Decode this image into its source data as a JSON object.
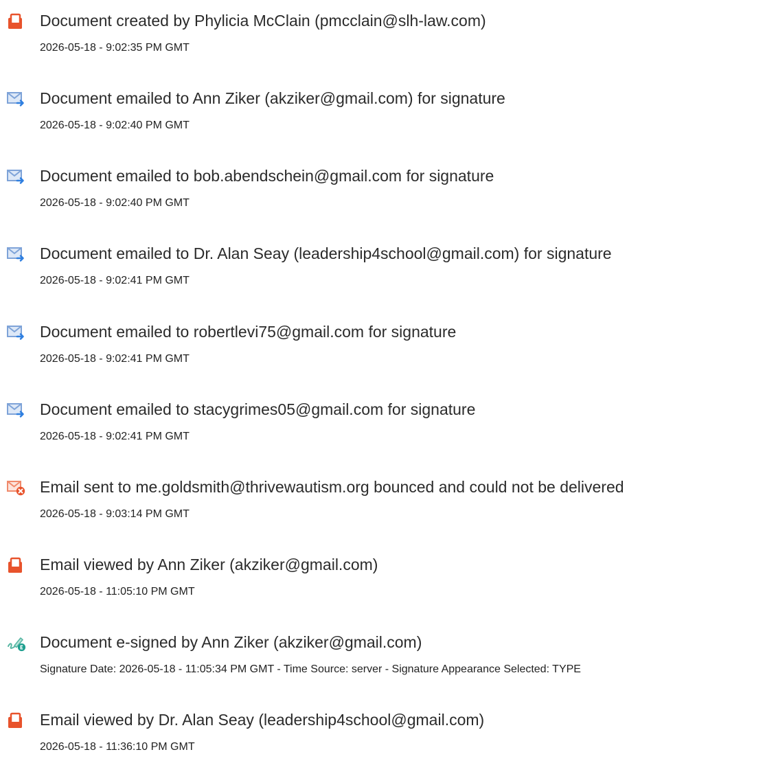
{
  "events": [
    {
      "icon": "document-created-icon",
      "title": "Document created by Phylicia McClain (pmcclain@slh-law.com)",
      "meta": "2026-05-18 - 9:02:35 PM GMT"
    },
    {
      "icon": "email-sent-icon",
      "title": "Document emailed to Ann Ziker (akziker@gmail.com) for signature",
      "meta": "2026-05-18 - 9:02:40 PM GMT"
    },
    {
      "icon": "email-sent-icon",
      "title": "Document emailed to bob.abendschein@gmail.com for signature",
      "meta": "2026-05-18 - 9:02:40 PM GMT"
    },
    {
      "icon": "email-sent-icon",
      "title": "Document emailed to Dr. Alan Seay (leadership4school@gmail.com) for signature",
      "meta": "2026-05-18 - 9:02:41 PM GMT"
    },
    {
      "icon": "email-sent-icon",
      "title": "Document emailed to robertlevi75@gmail.com for signature",
      "meta": "2026-05-18 - 9:02:41 PM GMT"
    },
    {
      "icon": "email-sent-icon",
      "title": "Document emailed to stacygrimes05@gmail.com for signature",
      "meta": "2026-05-18 - 9:02:41 PM GMT"
    },
    {
      "icon": "email-bounced-icon",
      "title": "Email sent to me.goldsmith@thrivewautism.org bounced and could not be delivered",
      "meta": "2026-05-18 - 9:03:14 PM GMT"
    },
    {
      "icon": "document-viewed-icon",
      "title": "Email viewed by Ann Ziker (akziker@gmail.com)",
      "meta": "2026-05-18 - 11:05:10 PM GMT"
    },
    {
      "icon": "e-signed-icon",
      "title": "Document e-signed by Ann Ziker (akziker@gmail.com)",
      "meta": "Signature Date: 2026-05-18 - 11:05:34 PM GMT - Time Source: server - Signature Appearance Selected: TYPE"
    },
    {
      "icon": "document-viewed-icon",
      "title": "Email viewed by Dr. Alan Seay (leadership4school@gmail.com)",
      "meta": "2026-05-18 - 11:36:10 PM GMT"
    }
  ],
  "colors": {
    "document_icon": "#e8532c",
    "email_icon": "#7ea3d8",
    "email_arrow": "#2f7fe0",
    "bounce_badge": "#e8532c",
    "esign_pen": "#57b6a3",
    "esign_badge": "#1e9f8f",
    "title_text": "#2b2b2b",
    "meta_text": "#222222"
  }
}
